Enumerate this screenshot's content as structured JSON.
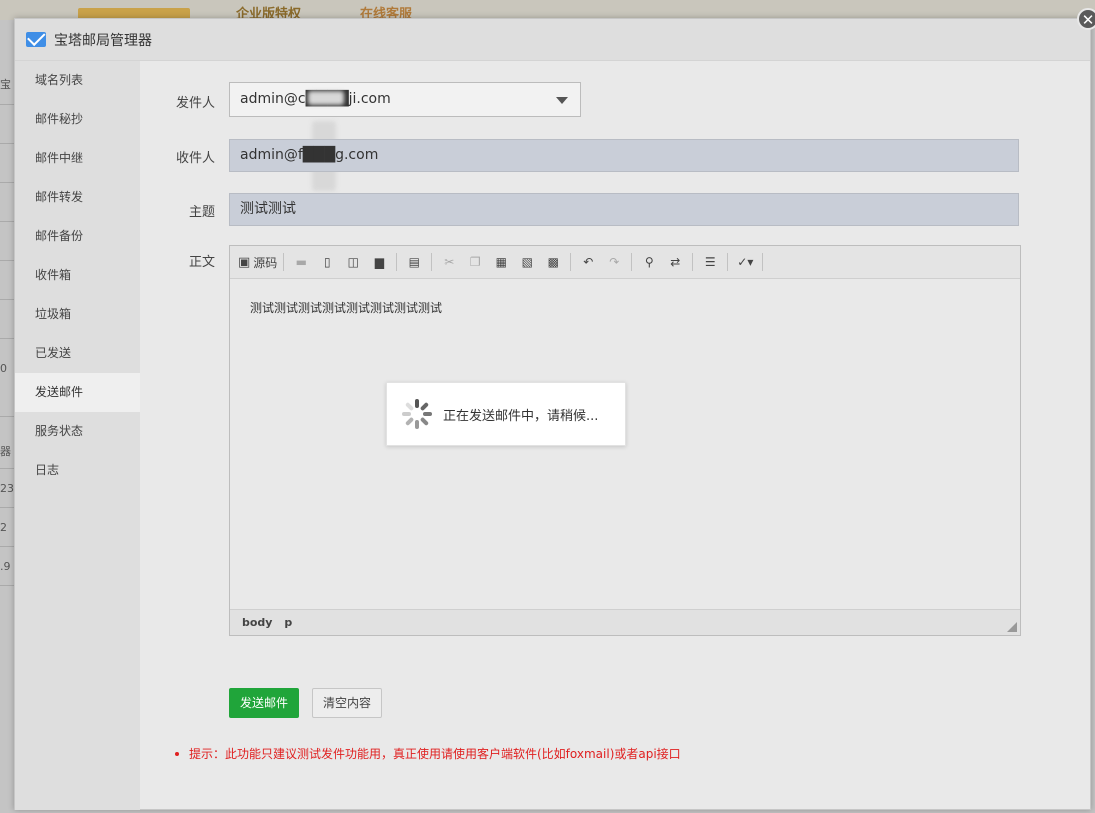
{
  "background": {
    "links": [
      "企业版特权",
      "在线客服"
    ],
    "edge_texts": [
      "宝",
      "0",
      "器",
      "23",
      "2",
      ".9"
    ]
  },
  "window": {
    "title": "宝塔邮局管理器",
    "close_label": "✕"
  },
  "sidebar": {
    "items": [
      {
        "label": "域名列表"
      },
      {
        "label": "邮件秘抄"
      },
      {
        "label": "邮件中继"
      },
      {
        "label": "邮件转发"
      },
      {
        "label": "邮件备份"
      },
      {
        "label": "收件箱"
      },
      {
        "label": "垃圾箱"
      },
      {
        "label": "已发送"
      },
      {
        "label": "发送邮件"
      },
      {
        "label": "服务状态"
      },
      {
        "label": "日志"
      }
    ],
    "active_index": 8
  },
  "form": {
    "sender_label": "发件人",
    "sender_value": "admin@c████ji.com",
    "recipient_label": "收件人",
    "recipient_value": "admin@f███g.com",
    "subject_label": "主题",
    "subject_value": "测试测试",
    "body_label": "正文"
  },
  "editor": {
    "source_label": "源码",
    "content": "测试测试测试测试测试测试测试测试",
    "status_path": [
      "body",
      "p"
    ]
  },
  "actions": {
    "send_label": "发送邮件",
    "clear_label": "清空内容"
  },
  "tip": "提示：此功能只建议测试发件功能用，真正使用请使用客户端软件(比如foxmail)或者api接口",
  "loading": {
    "text": "正在发送邮件中，请稍候..."
  },
  "colors": {
    "send_button": "#20a53a",
    "tip_text": "#e02020",
    "mail_icon": "#3f8ee6"
  }
}
